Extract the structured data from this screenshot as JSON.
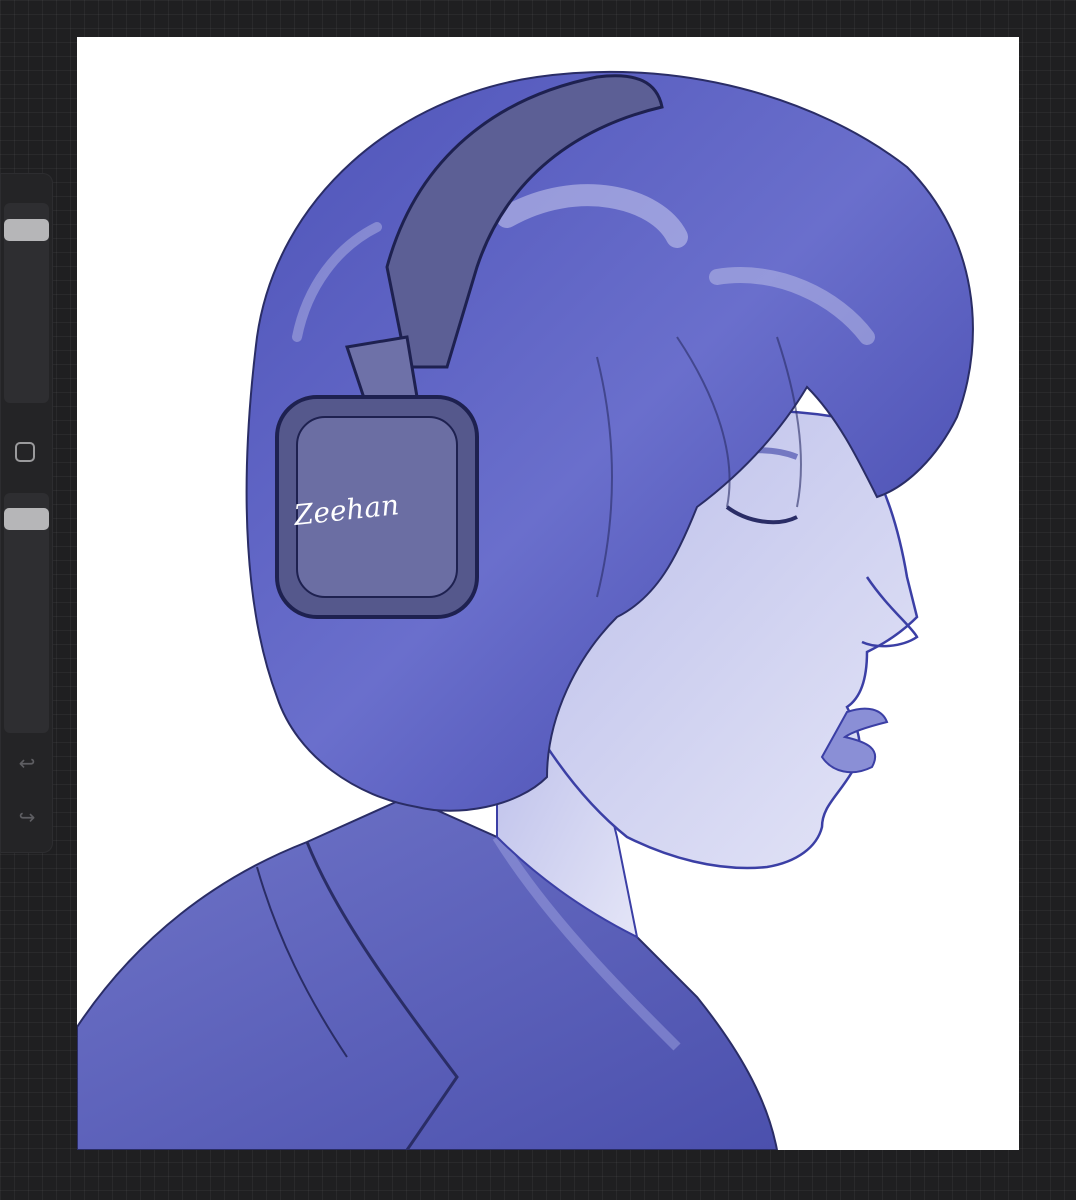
{
  "app": {
    "background_color": "#1f1f21",
    "accent_color": "#3a3fa8"
  },
  "sidebar": {
    "brush_size_slider": {
      "value_percent": 93
    },
    "opacity_slider": {
      "value_percent": 95
    },
    "modify_button": {
      "icon": "square-outline-icon"
    },
    "undo_button": {
      "icon": "undo-arrow-icon",
      "glyph": "↩"
    },
    "redo_button": {
      "icon": "redo-arrow-icon",
      "glyph": "↪"
    }
  },
  "canvas": {
    "artwork": {
      "subject": "profile-portrait-with-headphones",
      "signature_text": "Zeehan",
      "palette": [
        "#3b3fa5",
        "#5a5fbf",
        "#8a8fd6",
        "#c9cbee",
        "#2a2d66"
      ]
    }
  }
}
